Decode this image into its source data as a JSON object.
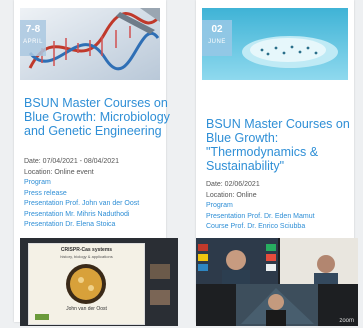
{
  "cards": [
    {
      "badge_day": "7-8",
      "badge_month": "APRIL",
      "title": "BSUN Master Courses on Blue Growth: Microbiology and Genetic Engineering",
      "date": "Date: 07/04/2021 - 08/04/2021",
      "location": "Location: Online event",
      "links": [
        "Program",
        "Press release",
        "Presentation Prof. John van der Oost",
        "Presentation Mr. Mihris Naduthodi",
        "Presentation Dr. Elena Stoica"
      ]
    },
    {
      "badge_day": "02",
      "badge_month": "JUNE",
      "title": "BSUN Master Courses on Blue Growth: \"Thermodynamics & Sustainability\"",
      "date": "Date: 02/06/2021",
      "location": "Location: Online",
      "links": [
        "Program",
        "Presentation Prof. Dr. Eden Mamut",
        "Course Prof. Dr. Enrico Sciubba"
      ]
    }
  ],
  "shot1": {
    "slide_title": "CRISPR-Cas systems",
    "slide_subtitle": "history, biology & applications",
    "speaker": "John van der Oost"
  },
  "shot2": {
    "watermark": "zoom"
  },
  "colors": {
    "link": "#2f8fd6",
    "background": "#eef0f2"
  }
}
